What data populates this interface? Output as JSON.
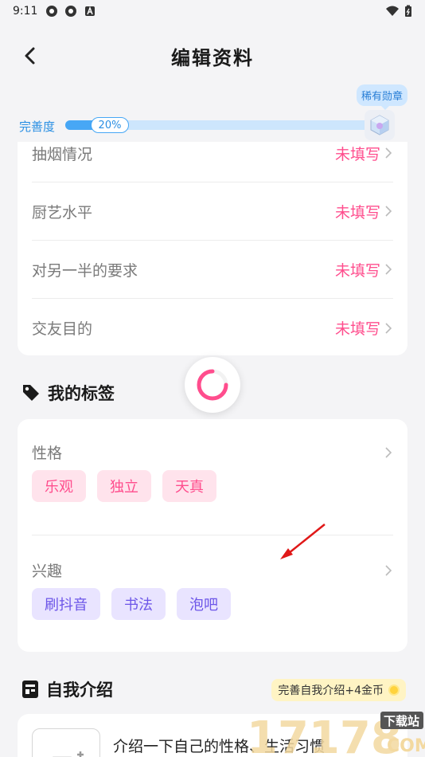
{
  "status_bar": {
    "time": "9:11"
  },
  "header": {
    "title": "编辑资料"
  },
  "progress": {
    "label": "完善度",
    "percent_text": "20%",
    "value": 0.2,
    "rare_badge": "稀有勋章"
  },
  "colors": {
    "accent_blue": "#47a7f5",
    "pink": "#ff4d8d",
    "purple": "#6c55e8"
  },
  "profile_rows": [
    {
      "label": "抽烟情况",
      "value": "未填写"
    },
    {
      "label": "厨艺水平",
      "value": "未填写"
    },
    {
      "label": "对另一半的要求",
      "value": "未填写"
    },
    {
      "label": "交友目的",
      "value": "未填写"
    }
  ],
  "tags_section": {
    "title": "我的标签",
    "personality": {
      "label": "性格",
      "tags": [
        "乐观",
        "独立",
        "天真"
      ]
    },
    "interests": {
      "label": "兴趣",
      "tags": [
        "刷抖音",
        "书法",
        "泡吧"
      ]
    }
  },
  "intro_section": {
    "title": "自我介绍",
    "reward_badge": "完善自我介绍+4金币",
    "prompt": "介绍一下自己的性格、生活习惯"
  },
  "watermark": {
    "number": "17178",
    "site": "下载站",
    "domain": "COM"
  },
  "icons": [
    "back-arrow-icon",
    "tag-icon",
    "intro-icon",
    "coin-icon",
    "medal-icon",
    "chevron-right-icon",
    "loading-spinner-icon"
  ]
}
